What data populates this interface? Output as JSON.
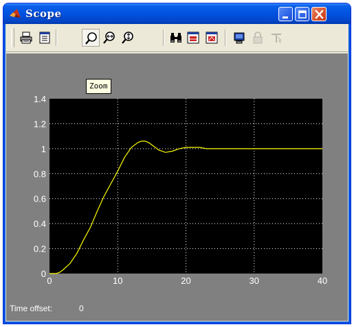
{
  "window": {
    "title": "Scope",
    "controls": [
      "minimize-icon",
      "maximize-icon",
      "close-icon"
    ]
  },
  "toolbar": {
    "tools": [
      {
        "name": "print-button",
        "icon": "printer-icon"
      },
      {
        "name": "parameters-button",
        "icon": "parameters-icon"
      },
      {
        "name": "zoom-button",
        "icon": "zoom-icon",
        "pressed": true
      },
      {
        "name": "zoom-x-button",
        "icon": "zoom-x-icon"
      },
      {
        "name": "zoom-y-button",
        "icon": "zoom-y-icon"
      },
      {
        "name": "autoscale-button",
        "icon": "binoculars-icon"
      },
      {
        "name": "save-axes-button",
        "icon": "save-axes-icon"
      },
      {
        "name": "restore-axes-button",
        "icon": "restore-axes-icon"
      },
      {
        "name": "floating-scope-button",
        "icon": "floating-scope-icon"
      },
      {
        "name": "lock-axes-button",
        "icon": "lock-icon",
        "disabled": true
      },
      {
        "name": "signal-selector-button",
        "icon": "signal-selector-icon",
        "disabled": true
      }
    ],
    "tooltip": "Zoom"
  },
  "status": {
    "time_offset_label": "Time offset:",
    "time_offset_value": "0"
  },
  "colors": {
    "plot_background": "#000000",
    "figure_background": "#808080",
    "trace": "#FFFF00",
    "grid": "#FFFFFF"
  },
  "chart_data": {
    "type": "line",
    "title": "",
    "xlabel": "",
    "ylabel": "",
    "xlim": [
      0,
      40
    ],
    "ylim": [
      0,
      1.4
    ],
    "x_ticks": [
      "0",
      "10",
      "20",
      "30",
      "40"
    ],
    "y_ticks": [
      "0",
      "0.2",
      "0.4",
      "0.6",
      "0.8",
      "1",
      "1.2",
      "1.4"
    ],
    "grid": true,
    "series": [
      {
        "x": [
          0,
          1,
          1.5,
          2,
          3,
          4,
          5,
          6,
          7,
          8,
          9,
          10,
          11,
          12,
          13,
          13.5,
          14,
          14.5,
          15,
          16,
          17,
          18,
          19,
          20,
          21,
          22,
          23,
          24,
          25,
          26,
          27,
          28,
          29,
          30,
          31,
          32,
          33,
          34,
          35,
          36,
          37,
          38,
          39,
          40
        ],
        "y": [
          0,
          0,
          0.01,
          0.03,
          0.08,
          0.16,
          0.27,
          0.37,
          0.5,
          0.62,
          0.72,
          0.82,
          0.93,
          1.01,
          1.05,
          1.06,
          1.06,
          1.05,
          1.03,
          0.99,
          0.97,
          0.98,
          1.0,
          1.01,
          1.01,
          1.01,
          1.0,
          1.0,
          1.0,
          1.0,
          1.0,
          1.0,
          1.0,
          1.0,
          1.0,
          1.0,
          1.0,
          1.0,
          1.0,
          1.0,
          1.0,
          1.0,
          1.0,
          1.0
        ]
      }
    ]
  }
}
